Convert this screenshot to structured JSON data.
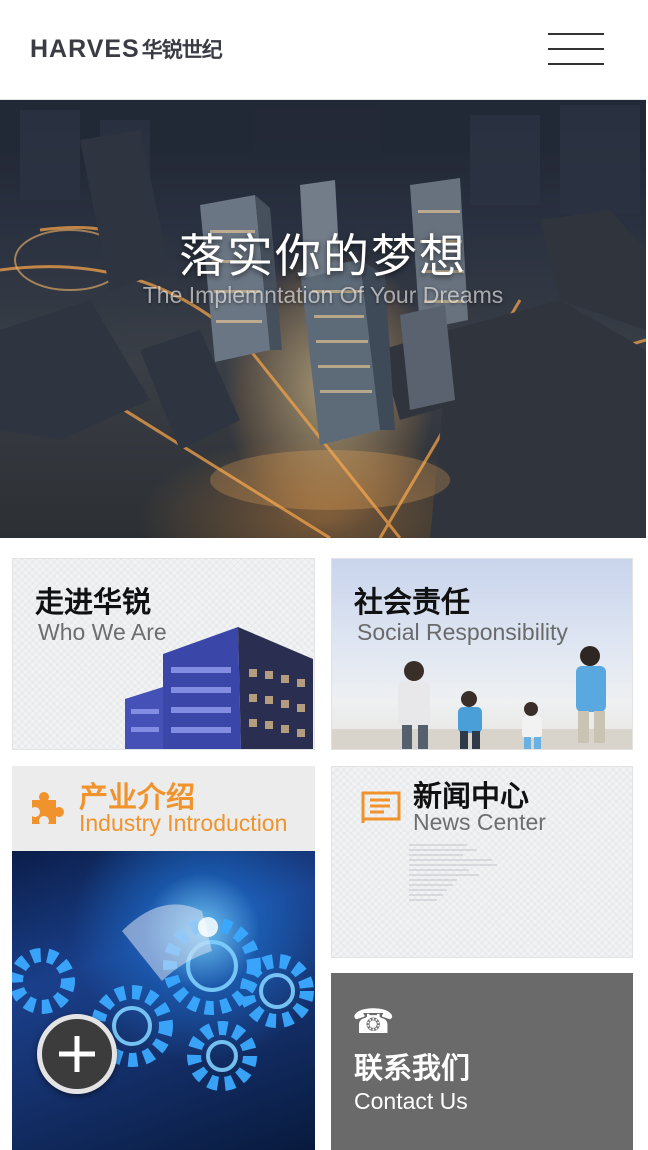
{
  "header": {
    "logo_en": "HARVES",
    "logo_cn": "华锐世纪",
    "menu_icon": "hamburger-menu-icon"
  },
  "hero": {
    "title": "落实你的梦想",
    "subtitle": "The Implemntation Of Your Dreams"
  },
  "tiles": {
    "who": {
      "cn": "走进华锐",
      "en": "Who We Are"
    },
    "social": {
      "cn": "社会责任",
      "en": "Social Responsibility"
    },
    "industry": {
      "cn": "产业介绍",
      "en": "Industry Introduction",
      "icon": "puzzle-icon"
    },
    "news": {
      "cn": "新闻中心",
      "en": "News Center",
      "icon": "newspaper-icon"
    },
    "contact": {
      "cn": "联系我们",
      "en": "Contact Us",
      "icon": "phone-icon"
    }
  },
  "colors": {
    "accent": "#f0932c",
    "contact_bg": "#6a6a6a",
    "text_dark": "#111111",
    "text_gray": "#6e6e6e"
  }
}
